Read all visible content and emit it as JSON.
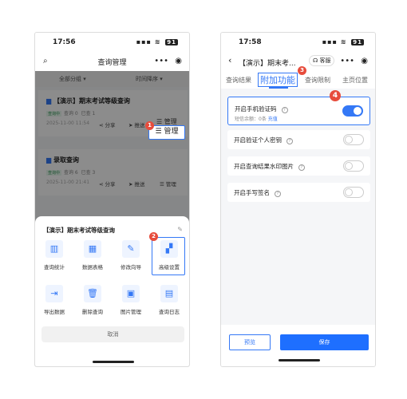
{
  "left": {
    "time": "17:56",
    "battery": "91",
    "nav_title": "查询管理",
    "filter_all": "全部分组",
    "filter_sort": "时间降序",
    "card1": {
      "title": "【演示】期末考试等级查询",
      "status": "查询中",
      "query": "查询 0",
      "sent": "已查 1",
      "date": "2025-11-00 11:54",
      "share": "分享",
      "push": "推送",
      "manage": "管理"
    },
    "card2": {
      "title": "录取查询",
      "status": "查询中",
      "query": "查询 6",
      "sent": "已查 3",
      "date": "2025-11-00 21:41",
      "share": "分享",
      "push": "推送",
      "manage": "管理"
    },
    "sheet_title": "【演示】期末考试等级查询",
    "items": [
      "查询统计",
      "数据表格",
      "修改向导",
      "高级设置",
      "导出数据",
      "删除查询",
      "图片管理",
      "查询日志"
    ],
    "cancel": "取消",
    "badge1": "1",
    "badge2": "2"
  },
  "right": {
    "time": "17:58",
    "battery": "91",
    "nav_title": "【演示】期末考...",
    "service": "客服",
    "tabs": [
      "查询结果",
      "附加功能",
      "查询限制",
      "主页位置"
    ],
    "badge3": "3",
    "badge4": "4",
    "rows": [
      {
        "label": "开启手机验证码",
        "sub": "短信余额：0条",
        "link": "充值",
        "on": true
      },
      {
        "label": "开启验证个人密钥",
        "on": false
      },
      {
        "label": "开启查询结果水印图片",
        "on": false
      },
      {
        "label": "开启手写签名",
        "on": false
      }
    ],
    "preview": "预览",
    "save": "保存"
  }
}
